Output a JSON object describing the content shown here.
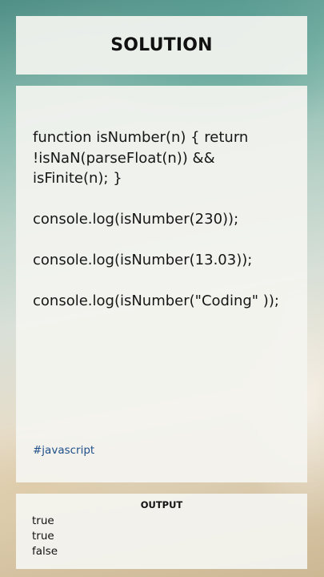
{
  "header": {
    "title": "SOLUTION"
  },
  "code": {
    "lines": [
      "function isNumber(n) { return !isNaN(parseFloat(n)) && isFinite(n); }",
      "console.log(isNumber(230));",
      "console.log(isNumber(13.03));",
      "console.log(isNumber(\"Coding\" ));"
    ],
    "hashtag": "#javascript"
  },
  "output": {
    "heading": "OUTPUT",
    "lines": [
      "true",
      "true",
      "false"
    ]
  },
  "colors": {
    "panel_background": "#f4f4f0",
    "hashtag": "#1f4f8a",
    "text": "#111111"
  }
}
